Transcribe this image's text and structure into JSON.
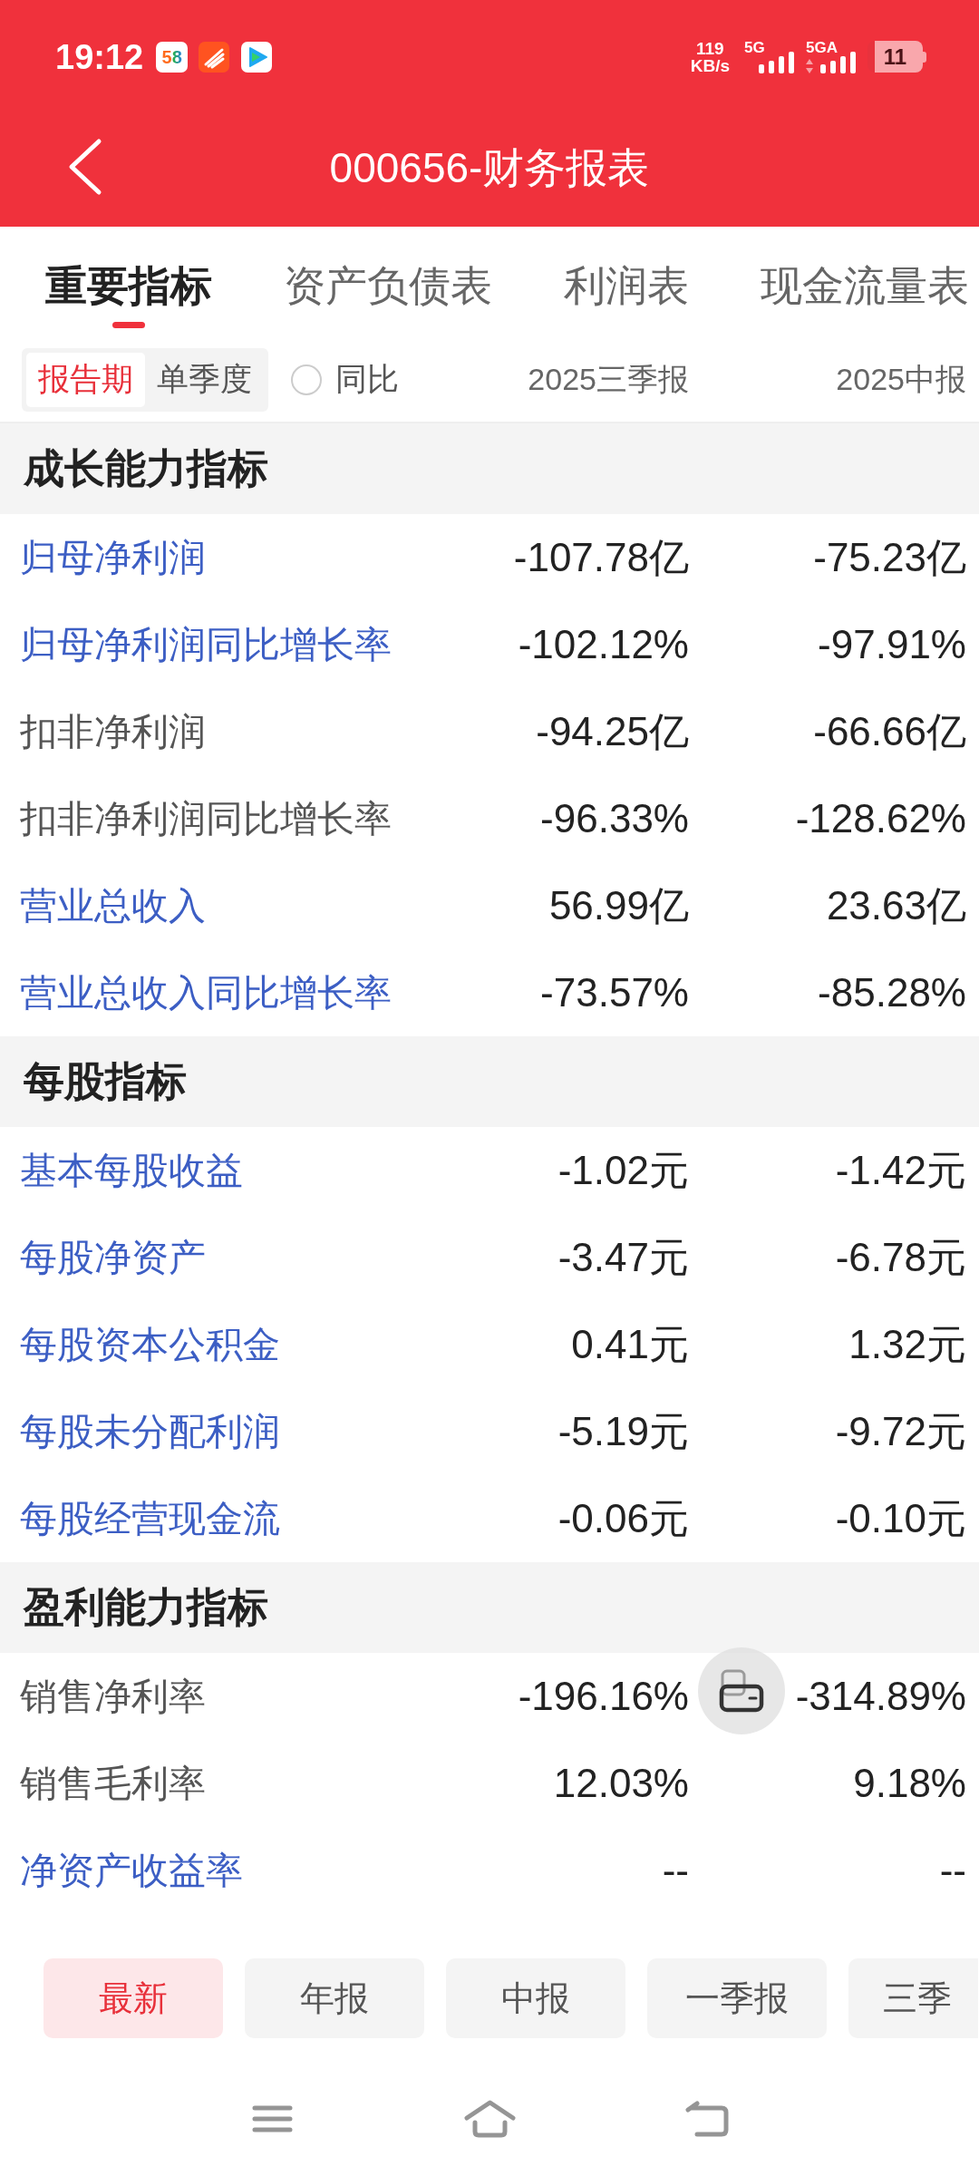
{
  "status_bar": {
    "time": "19:12",
    "app_logo": "58",
    "net_speed": "119",
    "net_speed_unit": "KB/s",
    "sim_1_network": "5G",
    "sim_2_network": "5GA",
    "battery": "11"
  },
  "header": {
    "title": "000656-财务报表"
  },
  "tabs": [
    {
      "label": "重要指标",
      "selected": true
    },
    {
      "label": "资产负债表",
      "selected": false
    },
    {
      "label": "利润表",
      "selected": false
    },
    {
      "label": "现金流量表",
      "selected": false
    }
  ],
  "filter_bar": {
    "periods": [
      {
        "label": "报告期",
        "selected": true
      },
      {
        "label": "单季度",
        "selected": false
      }
    ],
    "yoy": {
      "label": "同比",
      "checked": false
    },
    "columns": [
      "2025三季报",
      "2025中报"
    ]
  },
  "sections": [
    {
      "title": "成长能力指标",
      "rows": [
        {
          "label": "归母净利润",
          "linked": true,
          "values": [
            "-107.78亿",
            "-75.23亿"
          ]
        },
        {
          "label": "归母净利润同比增长率",
          "linked": true,
          "values": [
            "-102.12%",
            "-97.91%"
          ]
        },
        {
          "label": "扣非净利润",
          "linked": false,
          "values": [
            "-94.25亿",
            "-66.66亿"
          ]
        },
        {
          "label": "扣非净利润同比增长率",
          "linked": false,
          "values": [
            "-96.33%",
            "-128.62%"
          ]
        },
        {
          "label": "营业总收入",
          "linked": true,
          "values": [
            "56.99亿",
            "23.63亿"
          ]
        },
        {
          "label": "营业总收入同比增长率",
          "linked": true,
          "values": [
            "-73.57%",
            "-85.28%"
          ]
        }
      ]
    },
    {
      "title": "每股指标",
      "rows": [
        {
          "label": "基本每股收益",
          "linked": true,
          "values": [
            "-1.02元",
            "-1.42元"
          ]
        },
        {
          "label": "每股净资产",
          "linked": true,
          "values": [
            "-3.47元",
            "-6.78元"
          ]
        },
        {
          "label": "每股资本公积金",
          "linked": true,
          "values": [
            "0.41元",
            "1.32元"
          ]
        },
        {
          "label": "每股未分配利润",
          "linked": true,
          "values": [
            "-5.19元",
            "-9.72元"
          ]
        },
        {
          "label": "每股经营现金流",
          "linked": true,
          "values": [
            "-0.06元",
            "-0.10元"
          ]
        }
      ]
    },
    {
      "title": "盈利能力指标",
      "rows": [
        {
          "label": "销售净利率",
          "linked": false,
          "values": [
            "-196.16%",
            "-314.89%"
          ]
        },
        {
          "label": "销售毛利率",
          "linked": false,
          "values": [
            "12.03%",
            "9.18%"
          ]
        },
        {
          "label": "净资产收益率",
          "linked": true,
          "values": [
            "--",
            "--"
          ]
        }
      ]
    }
  ],
  "period_chips": [
    {
      "label": "最新",
      "selected": true
    },
    {
      "label": "年报",
      "selected": false
    },
    {
      "label": "中报",
      "selected": false
    },
    {
      "label": "一季报",
      "selected": false
    },
    {
      "label": "三季",
      "selected": false
    }
  ]
}
